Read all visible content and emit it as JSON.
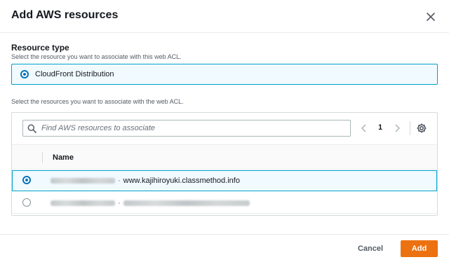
{
  "dialog": {
    "title": "Add AWS resources",
    "close_icon": "close-icon"
  },
  "resource_type": {
    "label": "Resource type",
    "description": "Select the resource you want to associate with this web ACL.",
    "selected_option": "CloudFront Distribution"
  },
  "resources": {
    "description": "Select the resources you want to associate with the web ACL.",
    "search": {
      "placeholder": "Find AWS resources to associate",
      "value": "",
      "icon": "search-icon"
    },
    "pagination": {
      "current_page": "1",
      "prev_icon": "chevron-left-icon",
      "next_icon": "chevron-right-icon"
    },
    "settings_icon": "gear-icon",
    "columns": [
      "Name"
    ],
    "rows": [
      {
        "selected": true,
        "name_visible": "www.kajihiroyuki.classmethod.info"
      },
      {
        "selected": false,
        "name_visible": ""
      }
    ]
  },
  "footer": {
    "cancel_label": "Cancel",
    "add_label": "Add"
  },
  "colors": {
    "accent": "#0073bb",
    "selected_border": "#00a1c9",
    "selected_bg": "#f1faff",
    "primary_button": "#ec7211"
  }
}
